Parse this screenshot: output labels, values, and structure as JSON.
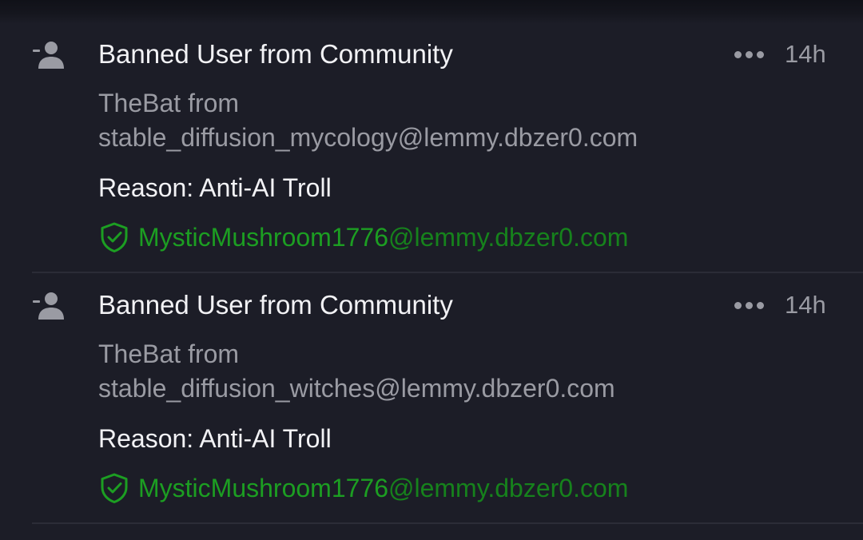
{
  "colors": {
    "background": "#1c1d27",
    "primary_text": "#f2f2f5",
    "secondary_text": "#9a9ba3",
    "moderator_green": "#1c9e22",
    "divider": "#2b2c37"
  },
  "items": [
    {
      "icon": "user-ban-icon",
      "title": "Banned User from Community",
      "timestamp": "14h",
      "detail_line1": "TheBat from",
      "detail_line2": "stable_diffusion_mycology@lemmy.dbzer0.com",
      "reason": "Reason: Anti-AI Troll",
      "moderator_name": "MysticMushroom1776",
      "moderator_instance": "@lemmy.dbzer0.com",
      "moderator_icon": "shield-check-icon"
    },
    {
      "icon": "user-ban-icon",
      "title": "Banned User from Community",
      "timestamp": "14h",
      "detail_line1": "TheBat from",
      "detail_line2": "stable_diffusion_witches@lemmy.dbzer0.com",
      "reason": "Reason: Anti-AI Troll",
      "moderator_name": "MysticMushroom1776",
      "moderator_instance": "@lemmy.dbzer0.com",
      "moderator_icon": "shield-check-icon"
    }
  ]
}
